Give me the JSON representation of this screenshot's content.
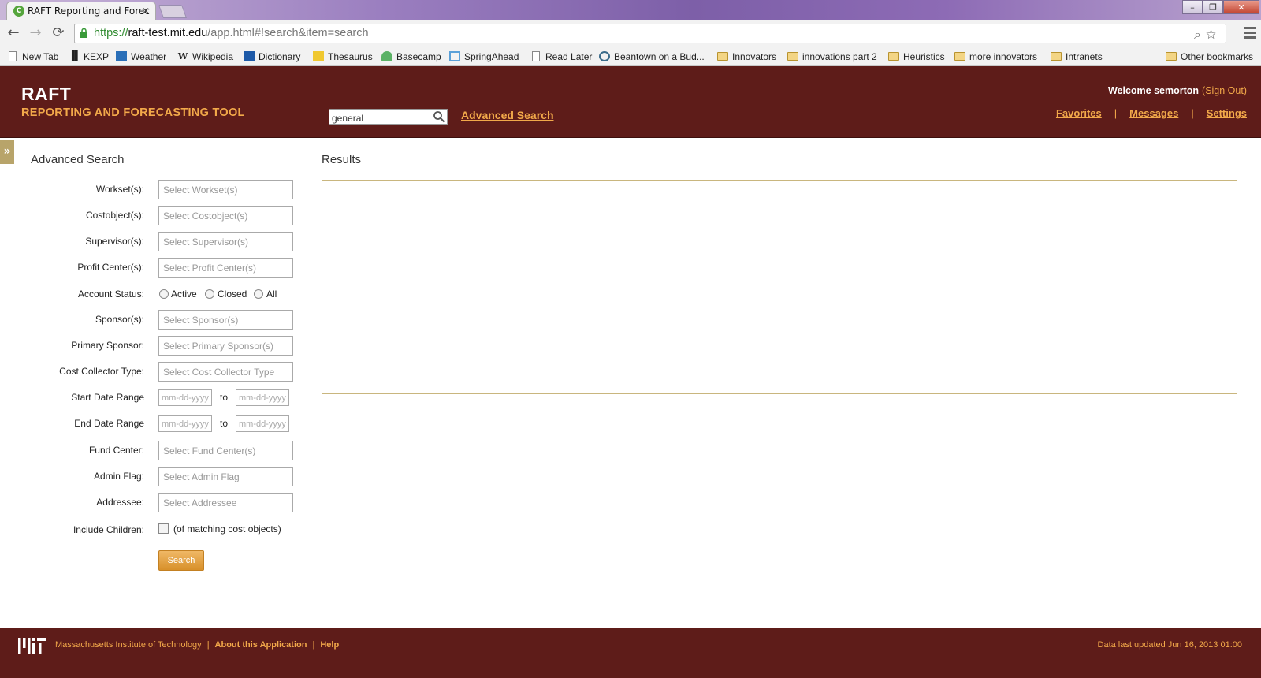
{
  "browser": {
    "tab_title": "RAFT Reporting and Forec",
    "tab_favicon_letter": "C",
    "url_scheme": "https://",
    "url_host": "raft-test.mit.edu",
    "url_path": "/app.html#!search&item=search",
    "bookmarks": [
      {
        "label": "New Tab",
        "icon": "page-icon"
      },
      {
        "label": "KEXP",
        "icon": "kexp-icon"
      },
      {
        "label": "Weather",
        "icon": "weather-icon"
      },
      {
        "label": "Wikipedia",
        "icon": "wikipedia-icon"
      },
      {
        "label": "Dictionary",
        "icon": "dictionary-icon"
      },
      {
        "label": "Thesaurus",
        "icon": "thesaurus-icon"
      },
      {
        "label": "Basecamp",
        "icon": "basecamp-icon"
      },
      {
        "label": "SpringAhead",
        "icon": "springahead-icon"
      },
      {
        "label": "Read Later",
        "icon": "page-icon"
      },
      {
        "label": "Beantown on a Bud...",
        "icon": "wordpress-icon"
      },
      {
        "label": "Innovators",
        "icon": "folder-icon"
      },
      {
        "label": "innovations part 2",
        "icon": "folder-icon"
      },
      {
        "label": "Heuristics",
        "icon": "folder-icon"
      },
      {
        "label": "more innovators",
        "icon": "folder-icon"
      },
      {
        "label": "Intranets",
        "icon": "folder-icon"
      }
    ],
    "other_bookmarks": "Other bookmarks"
  },
  "header": {
    "brand": "RAFT",
    "subtitle": "REPORTING AND FORECASTING TOOL",
    "search_value": "general",
    "advanced_search_link": "Advanced Search",
    "welcome": "Welcome semorton",
    "sign_out": "(Sign Out)",
    "nav": [
      "Favorites",
      "Messages",
      "Settings"
    ]
  },
  "search_panel": {
    "title": "Advanced Search",
    "fields": {
      "workset": {
        "label": "Workset(s):",
        "placeholder": "Select Workset(s)"
      },
      "costobject": {
        "label": "Costobject(s):",
        "placeholder": "Select Costobject(s)"
      },
      "supervisor": {
        "label": "Supervisor(s):",
        "placeholder": "Select Supervisor(s)"
      },
      "profit_center": {
        "label": "Profit Center(s):",
        "placeholder": "Select Profit Center(s)"
      },
      "sponsor": {
        "label": "Sponsor(s):",
        "placeholder": "Select Sponsor(s)"
      },
      "primary_sponsor": {
        "label": "Primary Sponsor:",
        "placeholder": "Select Primary Sponsor(s)"
      },
      "cost_collector_type": {
        "label": "Cost Collector Type:",
        "placeholder": "Select Cost Collector Type"
      },
      "fund_center": {
        "label": "Fund Center:",
        "placeholder": "Select Fund Center(s)"
      },
      "admin_flag": {
        "label": "Admin Flag:",
        "placeholder": "Select Admin Flag"
      },
      "addressee": {
        "label": "Addressee:",
        "placeholder": "Select Addressee"
      }
    },
    "account_status": {
      "label": "Account Status:",
      "options": [
        "Active",
        "Closed",
        "All"
      ]
    },
    "start_date": {
      "label": "Start Date Range",
      "placeholder": "mm-dd-yyyy",
      "to": "to"
    },
    "end_date": {
      "label": "End Date Range",
      "placeholder": "mm-dd-yyyy",
      "to": "to"
    },
    "include_children": {
      "label": "Include Children:",
      "note": "(of matching cost objects)"
    },
    "search_button": "Search"
  },
  "results": {
    "title": "Results"
  },
  "footer": {
    "institution": "Massachusetts Institute of Technology",
    "about": "About this Application",
    "help": "Help",
    "last_updated": "Data last updated Jun 16, 2013 01:00"
  },
  "colors": {
    "header_bg": "#5e1c19",
    "accent": "#f2a94a",
    "results_border": "#c9b67e"
  }
}
